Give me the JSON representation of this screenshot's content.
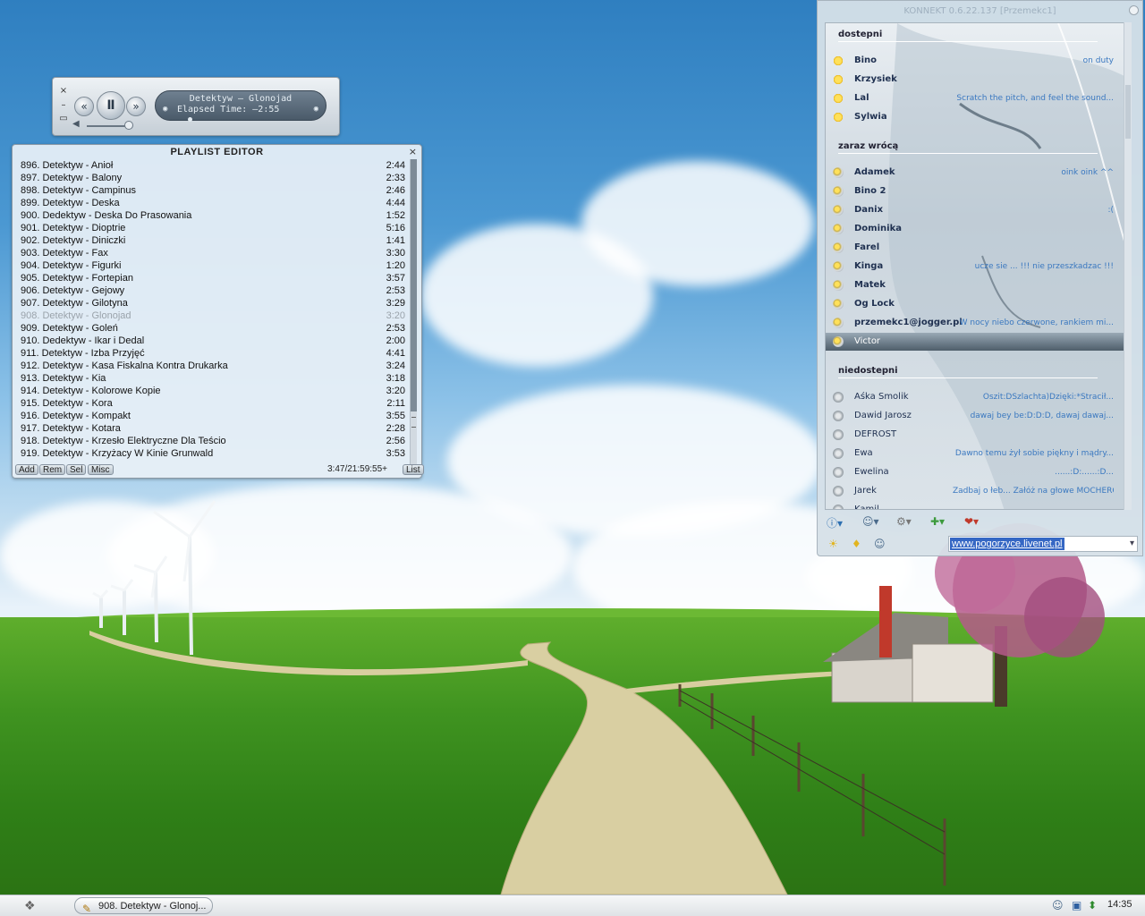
{
  "player": {
    "track_title": "Detektyw – Glonojad",
    "elapsed": "Elapsed Time: –2:55",
    "controls": {
      "close": "×",
      "minimize": "–",
      "shade": "▭",
      "prev": "«",
      "pause": "Ⅱ",
      "next": "»"
    }
  },
  "playlist": {
    "title": "PLAYLIST EDITOR",
    "close": "×",
    "tracks": [
      {
        "t": "896. Detektyw - Anioł",
        "d": "2:44"
      },
      {
        "t": "897. Detektyw - Balony",
        "d": "2:33"
      },
      {
        "t": "898. Detektyw - Campinus",
        "d": "2:46"
      },
      {
        "t": "899. Detektyw - Deska",
        "d": "4:44"
      },
      {
        "t": "900. Dedektyw - Deska Do Prasowania",
        "d": "1:52"
      },
      {
        "t": "901. Detektyw - Dioptrie",
        "d": "5:16"
      },
      {
        "t": "902. Detektyw - Diniczki",
        "d": "1:41"
      },
      {
        "t": "903. Detektyw - Fax",
        "d": "3:30"
      },
      {
        "t": "904. Detektyw - Figurki",
        "d": "1:20"
      },
      {
        "t": "905. Detektyw - Fortepian",
        "d": "3:57"
      },
      {
        "t": "906. Detektyw - Gejowy",
        "d": "2:53"
      },
      {
        "t": "907. Detektyw - Gilotyna",
        "d": "3:29"
      },
      {
        "t": "908. Detektyw - Glonojad",
        "d": "3:20"
      },
      {
        "t": "909. Detektyw - Goleń",
        "d": "2:53"
      },
      {
        "t": "910. Dedektyw - Ikar i Dedal",
        "d": "2:00"
      },
      {
        "t": "911. Detektyw - Izba Przyjęć",
        "d": "4:41"
      },
      {
        "t": "912. Detektyw - Kasa Fiskalna Kontra Drukarka",
        "d": "3:24"
      },
      {
        "t": "913. Detektyw - Kia",
        "d": "3:18"
      },
      {
        "t": "914. Detektyw - Kolorowe Kopie",
        "d": "3:20"
      },
      {
        "t": "915. Detektyw - Kora",
        "d": "2:11"
      },
      {
        "t": "916. Detektyw - Kompakt",
        "d": "3:55"
      },
      {
        "t": "917. Detektyw - Kotara",
        "d": "2:28"
      },
      {
        "t": "918. Detektyw - Krzesło Elektryczne Dla Teścio",
        "d": "2:56"
      },
      {
        "t": "919. Detektyw - Krzyżacy W Kinie Grunwald",
        "d": "3:53"
      }
    ],
    "current_index": 12,
    "buttons": {
      "add": "Add",
      "rem": "Rem",
      "sel": "Sel",
      "misc": "Misc",
      "list": "List"
    },
    "total": "3:47/21:59:55+"
  },
  "konnekt": {
    "title": "KONNEKT 0.6.22.137 [Przemekc1]",
    "groups": {
      "available": "dostepni",
      "back_soon": "zaraz wrócą",
      "unavailable": "niedostepni"
    },
    "available": [
      {
        "name": "Bino",
        "status": "on duty"
      },
      {
        "name": "Krzysiek",
        "status": ""
      },
      {
        "name": "Lal",
        "status": "Scratch the pitch, and feel the sound..."
      },
      {
        "name": "Sylwia",
        "status": ""
      }
    ],
    "back_soon": [
      {
        "name": "Adamek",
        "status": "oink oink ^^"
      },
      {
        "name": "Bino 2",
        "status": ""
      },
      {
        "name": "Danix",
        "status": ":("
      },
      {
        "name": "Dominika",
        "status": ""
      },
      {
        "name": "Farel",
        "status": ""
      },
      {
        "name": "Kinga",
        "status": "ucze sie ... !!! nie przeszkadzac !!!"
      },
      {
        "name": "Matek",
        "status": ""
      },
      {
        "name": "Og Lock",
        "status": ""
      },
      {
        "name": "przemekc1@jogger.pl",
        "status": "W nocy niebo czerwone, rankiem mi..."
      },
      {
        "name": "Victor",
        "status": ""
      }
    ],
    "unavailable": [
      {
        "name": "Aśka Smolik",
        "status": "Oszit:DSzlachta)Dzięki:*Stracił..."
      },
      {
        "name": "Dawid Jarosz",
        "status": "dawaj bey be:D:D:D, dawaj dawaj..."
      },
      {
        "name": "DEFROST",
        "status": ""
      },
      {
        "name": "Ewa",
        "status": "Dawno temu żył sobie piękny i mądry..."
      },
      {
        "name": "Ewelina",
        "status": "......:D:......:D..."
      },
      {
        "name": "Jarek",
        "status": "Zadbaj o łeb... Załóż na głowe MOCHEROWY BERET"
      },
      {
        "name": "Kamil",
        "status": ""
      }
    ],
    "status_text": "www.pogorzyce.livenet.pl"
  },
  "taskbar": {
    "task_label": "908. Detektyw - Glonoj...",
    "clock": "14:35"
  }
}
